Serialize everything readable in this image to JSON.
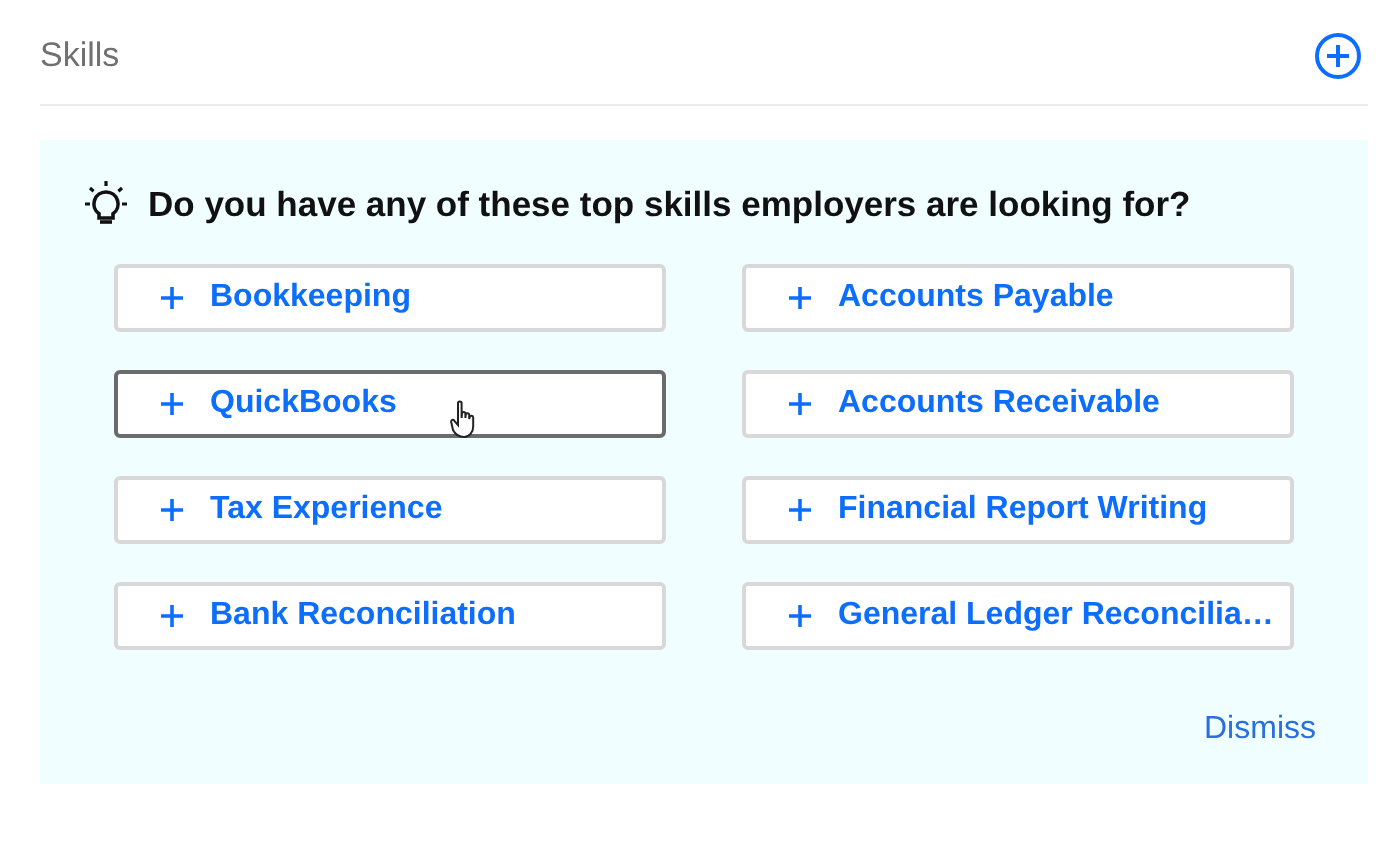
{
  "section": {
    "title": "Skills"
  },
  "suggestions": {
    "heading": "Do you have any of these top skills employers are looking for?",
    "skills": [
      {
        "label": "Bookkeeping",
        "hovered": false
      },
      {
        "label": "Accounts Payable",
        "hovered": false
      },
      {
        "label": "QuickBooks",
        "hovered": true
      },
      {
        "label": "Accounts Receivable",
        "hovered": false
      },
      {
        "label": "Tax Experience",
        "hovered": false
      },
      {
        "label": "Financial Report Writing",
        "hovered": false
      },
      {
        "label": "Bank Reconciliation",
        "hovered": false
      },
      {
        "label": "General Ledger Reconcilia…",
        "hovered": false
      }
    ],
    "dismiss": "Dismiss"
  }
}
